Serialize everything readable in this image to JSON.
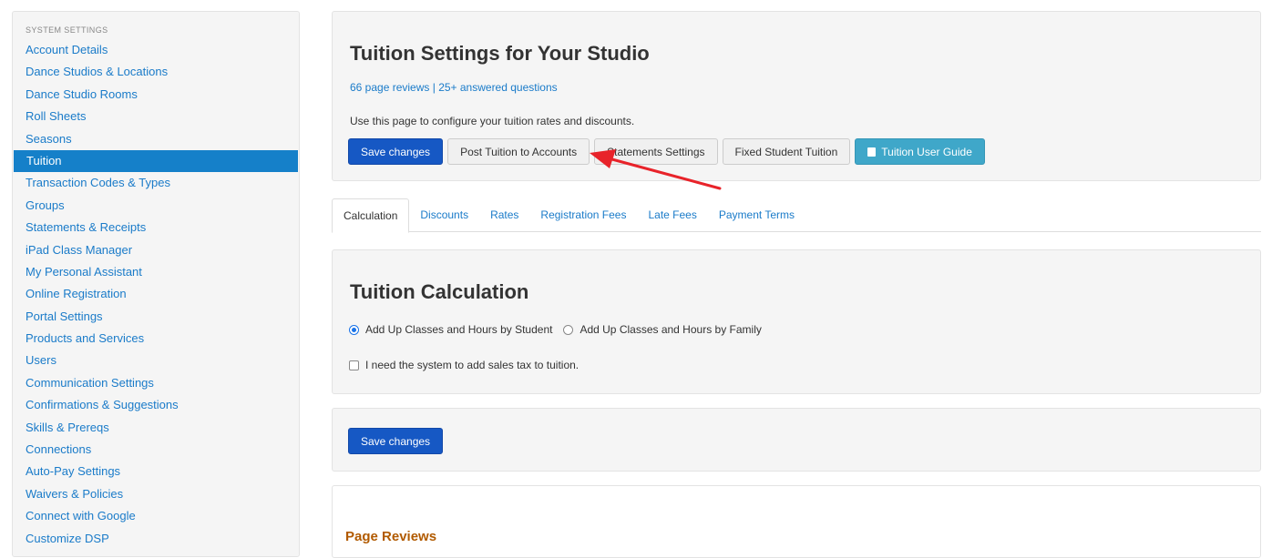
{
  "sidebar": {
    "heading": "SYSTEM SETTINGS",
    "items": [
      {
        "label": "Account Details"
      },
      {
        "label": "Dance Studios & Locations"
      },
      {
        "label": "Dance Studio Rooms"
      },
      {
        "label": "Roll Sheets"
      },
      {
        "label": "Seasons"
      },
      {
        "label": "Tuition",
        "active": true
      },
      {
        "label": "Transaction Codes & Types"
      },
      {
        "label": "Groups"
      },
      {
        "label": "Statements & Receipts"
      },
      {
        "label": "iPad Class Manager"
      },
      {
        "label": "My Personal Assistant"
      },
      {
        "label": "Online Registration"
      },
      {
        "label": "Portal Settings"
      },
      {
        "label": "Products and Services"
      },
      {
        "label": "Users"
      },
      {
        "label": "Communication Settings"
      },
      {
        "label": "Confirmations & Suggestions"
      },
      {
        "label": "Skills & Prereqs"
      },
      {
        "label": "Connections"
      },
      {
        "label": "Auto-Pay Settings"
      },
      {
        "label": "Waivers & Policies"
      },
      {
        "label": "Connect with Google"
      },
      {
        "label": "Customize DSP"
      }
    ]
  },
  "header": {
    "title": "Tuition Settings for Your Studio",
    "reviews_link": "66 page reviews",
    "separator": " | ",
    "questions_link": "25+ answered questions",
    "intro": "Use this page to configure your tuition rates and discounts.",
    "buttons": {
      "save": "Save changes",
      "post_tuition": "Post Tuition to Accounts",
      "statements": "Statements Settings",
      "fixed_tuition": "Fixed Student Tuition",
      "user_guide": "Tuition User Guide"
    }
  },
  "tabs": [
    {
      "label": "Calculation",
      "active": true
    },
    {
      "label": "Discounts"
    },
    {
      "label": "Rates"
    },
    {
      "label": "Registration Fees"
    },
    {
      "label": "Late Fees"
    },
    {
      "label": "Payment Terms"
    }
  ],
  "calculation": {
    "title": "Tuition Calculation",
    "option_student": "Add Up Classes and Hours by Student",
    "option_family": "Add Up Classes and Hours by Family",
    "selected": "student",
    "sales_tax_label": "I need the system to add sales tax to tuition.",
    "sales_tax_checked": false
  },
  "footer": {
    "save": "Save changes"
  },
  "reviews": {
    "title": "Page Reviews"
  },
  "colors": {
    "link": "#1a7bc9",
    "primary": "#1658c4",
    "info": "#3fa7c9",
    "annotation_arrow": "#e8232a",
    "reviews_heading": "#b15a00"
  }
}
